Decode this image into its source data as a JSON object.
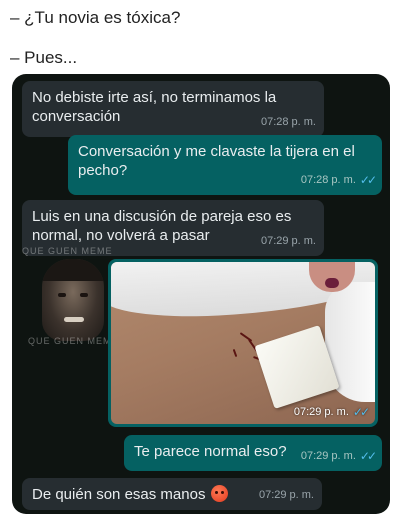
{
  "captions": {
    "line1": "– ¿Tu novia es tóxica?",
    "line2": "– Pues..."
  },
  "watermark": "QUE GUEN MEME",
  "messages": [
    {
      "direction": "incoming",
      "text": "No debiste irte así, no terminamos la conversación",
      "time": "07:28 p. m."
    },
    {
      "direction": "outgoing",
      "text": "Conversación y me clavaste la tijera en el pecho?",
      "time": "07:28 p. m."
    },
    {
      "direction": "incoming",
      "text": "Luis en una discusión de pareja eso es normal, no volverá a pasar",
      "time": "07:29 p. m."
    },
    {
      "direction": "outgoing",
      "type": "image",
      "time": "07:29 p. m."
    },
    {
      "direction": "outgoing",
      "text": "Te parece normal eso?",
      "time": "07:29 p. m."
    },
    {
      "direction": "incoming",
      "text": "De quién son esas manos",
      "emoji": "angry-face-icon",
      "time": "07:29 p. m."
    }
  ],
  "ticks": "✓✓",
  "colors": {
    "chat_background": "#0e1411",
    "incoming_bubble": "#262d31",
    "outgoing_bubble": "#056162",
    "read_ticks": "#53bdeb"
  }
}
